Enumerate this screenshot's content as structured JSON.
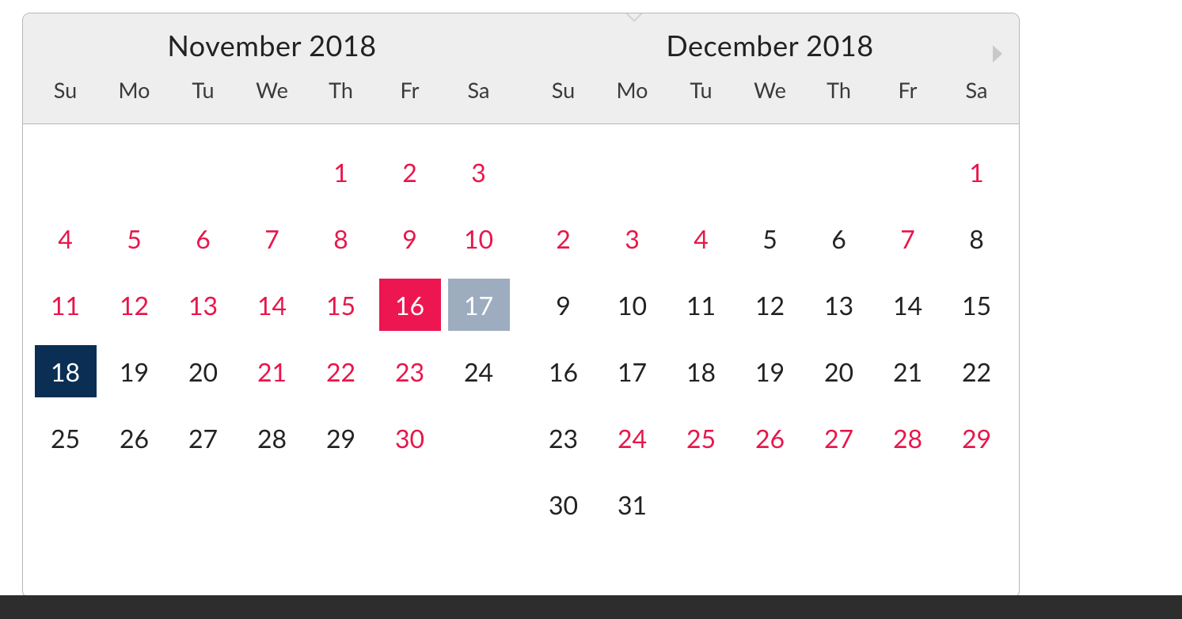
{
  "dow": [
    "Su",
    "Mo",
    "Tu",
    "We",
    "Th",
    "Fr",
    "Sa"
  ],
  "months": [
    {
      "title": "November 2018",
      "weeks": [
        [
          {
            "d": "",
            "s": "empty"
          },
          {
            "d": "",
            "s": "empty"
          },
          {
            "d": "",
            "s": "empty"
          },
          {
            "d": "",
            "s": "empty"
          },
          {
            "d": "1",
            "s": "pink"
          },
          {
            "d": "2",
            "s": "pink"
          },
          {
            "d": "3",
            "s": "pink"
          }
        ],
        [
          {
            "d": "4",
            "s": "pink"
          },
          {
            "d": "5",
            "s": "pink"
          },
          {
            "d": "6",
            "s": "pink"
          },
          {
            "d": "7",
            "s": "pink"
          },
          {
            "d": "8",
            "s": "pink"
          },
          {
            "d": "9",
            "s": "pink"
          },
          {
            "d": "10",
            "s": "pink"
          }
        ],
        [
          {
            "d": "11",
            "s": "pink"
          },
          {
            "d": "12",
            "s": "pink"
          },
          {
            "d": "13",
            "s": "pink"
          },
          {
            "d": "14",
            "s": "pink"
          },
          {
            "d": "15",
            "s": "pink"
          },
          {
            "d": "16",
            "s": "sel-red"
          },
          {
            "d": "17",
            "s": "sel-grey"
          }
        ],
        [
          {
            "d": "18",
            "s": "sel-navy"
          },
          {
            "d": "19",
            "s": ""
          },
          {
            "d": "20",
            "s": ""
          },
          {
            "d": "21",
            "s": "pink"
          },
          {
            "d": "22",
            "s": "pink"
          },
          {
            "d": "23",
            "s": "pink"
          },
          {
            "d": "24",
            "s": ""
          }
        ],
        [
          {
            "d": "25",
            "s": ""
          },
          {
            "d": "26",
            "s": ""
          },
          {
            "d": "27",
            "s": ""
          },
          {
            "d": "28",
            "s": ""
          },
          {
            "d": "29",
            "s": ""
          },
          {
            "d": "30",
            "s": "pink"
          },
          {
            "d": "",
            "s": "empty"
          }
        ]
      ]
    },
    {
      "title": "December 2018",
      "weeks": [
        [
          {
            "d": "",
            "s": "empty"
          },
          {
            "d": "",
            "s": "empty"
          },
          {
            "d": "",
            "s": "empty"
          },
          {
            "d": "",
            "s": "empty"
          },
          {
            "d": "",
            "s": "empty"
          },
          {
            "d": "",
            "s": "empty"
          },
          {
            "d": "1",
            "s": "pink"
          }
        ],
        [
          {
            "d": "2",
            "s": "pink"
          },
          {
            "d": "3",
            "s": "pink"
          },
          {
            "d": "4",
            "s": "pink"
          },
          {
            "d": "5",
            "s": ""
          },
          {
            "d": "6",
            "s": ""
          },
          {
            "d": "7",
            "s": "pink"
          },
          {
            "d": "8",
            "s": ""
          }
        ],
        [
          {
            "d": "9",
            "s": ""
          },
          {
            "d": "10",
            "s": ""
          },
          {
            "d": "11",
            "s": ""
          },
          {
            "d": "12",
            "s": ""
          },
          {
            "d": "13",
            "s": ""
          },
          {
            "d": "14",
            "s": ""
          },
          {
            "d": "15",
            "s": ""
          }
        ],
        [
          {
            "d": "16",
            "s": ""
          },
          {
            "d": "17",
            "s": ""
          },
          {
            "d": "18",
            "s": ""
          },
          {
            "d": "19",
            "s": ""
          },
          {
            "d": "20",
            "s": ""
          },
          {
            "d": "21",
            "s": ""
          },
          {
            "d": "22",
            "s": ""
          }
        ],
        [
          {
            "d": "23",
            "s": ""
          },
          {
            "d": "24",
            "s": "pink"
          },
          {
            "d": "25",
            "s": "pink"
          },
          {
            "d": "26",
            "s": "pink"
          },
          {
            "d": "27",
            "s": "pink"
          },
          {
            "d": "28",
            "s": "pink"
          },
          {
            "d": "29",
            "s": "pink"
          }
        ],
        [
          {
            "d": "30",
            "s": ""
          },
          {
            "d": "31",
            "s": ""
          },
          {
            "d": "",
            "s": "empty"
          },
          {
            "d": "",
            "s": "empty"
          },
          {
            "d": "",
            "s": "empty"
          },
          {
            "d": "",
            "s": "empty"
          },
          {
            "d": "",
            "s": "empty"
          }
        ]
      ]
    }
  ]
}
